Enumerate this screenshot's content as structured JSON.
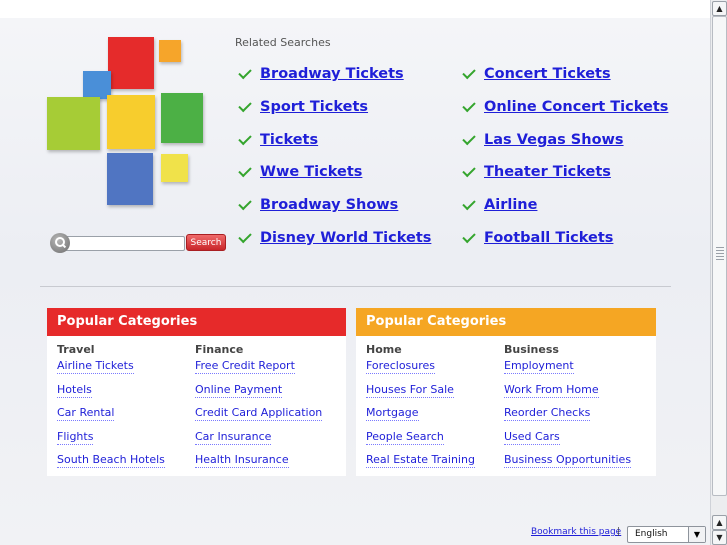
{
  "search": {
    "button_label": "Search"
  },
  "related": {
    "title": "Related Searches",
    "left": [
      "Broadway Tickets",
      "Sport Tickets",
      "Tickets",
      "Wwe Tickets",
      "Broadway Shows",
      "Disney World Tickets"
    ],
    "right": [
      "Concert Tickets",
      "Online Concert Tickets",
      "Las Vegas Shows",
      "Theater Tickets",
      "Airline",
      "Football Tickets"
    ]
  },
  "categories": [
    {
      "header": "Popular Categories",
      "color": "#e62a2a",
      "columns": [
        {
          "title": "Travel",
          "links": [
            "Airline Tickets",
            "Hotels",
            "Car Rental",
            "Flights",
            "South Beach Hotels"
          ]
        },
        {
          "title": "Finance",
          "links": [
            "Free Credit Report",
            "Online Payment",
            "Credit Card Application",
            "Car Insurance",
            "Health Insurance"
          ]
        }
      ]
    },
    {
      "header": "Popular Categories",
      "color": "#f5a623",
      "columns": [
        {
          "title": "Home",
          "links": [
            "Foreclosures",
            "Houses For Sale",
            "Mortgage",
            "People Search",
            "Real Estate Training"
          ]
        },
        {
          "title": "Business",
          "links": [
            "Employment",
            "Work From Home",
            "Reorder Checks",
            "Used Cars",
            "Business Opportunities"
          ]
        }
      ]
    }
  ],
  "footer": {
    "bookmark": "Bookmark this page",
    "separator": "|",
    "language": "English"
  },
  "colors": {
    "link": "#1f1fd8",
    "check": "#35a52e",
    "search_button": "#d93838"
  }
}
